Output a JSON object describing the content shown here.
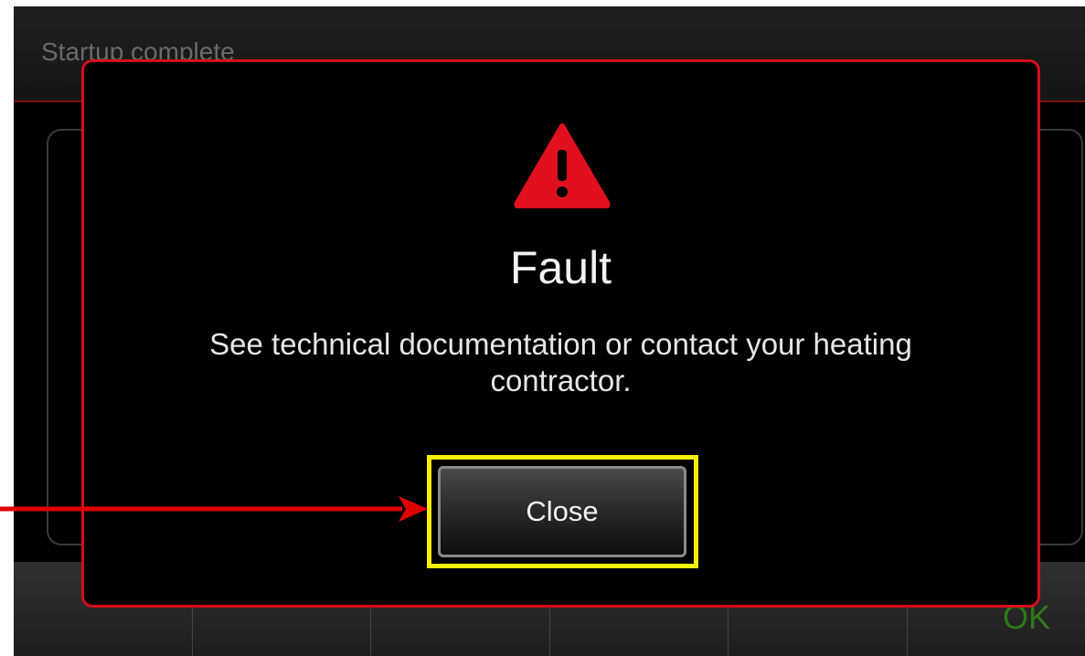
{
  "background": {
    "header_title": "Startup complete",
    "footer_ok_label": "OK"
  },
  "dialog": {
    "icon": "warning-triangle-icon",
    "title": "Fault",
    "message": "See technical documentation or contact your heating contractor.",
    "close_label": "Close"
  },
  "colors": {
    "dialog_border": "#d70d1a",
    "warning_icon": "#e0101e",
    "highlight": "#f7f000",
    "arrow": "#e00000",
    "ok_text": "#2f7a16"
  }
}
